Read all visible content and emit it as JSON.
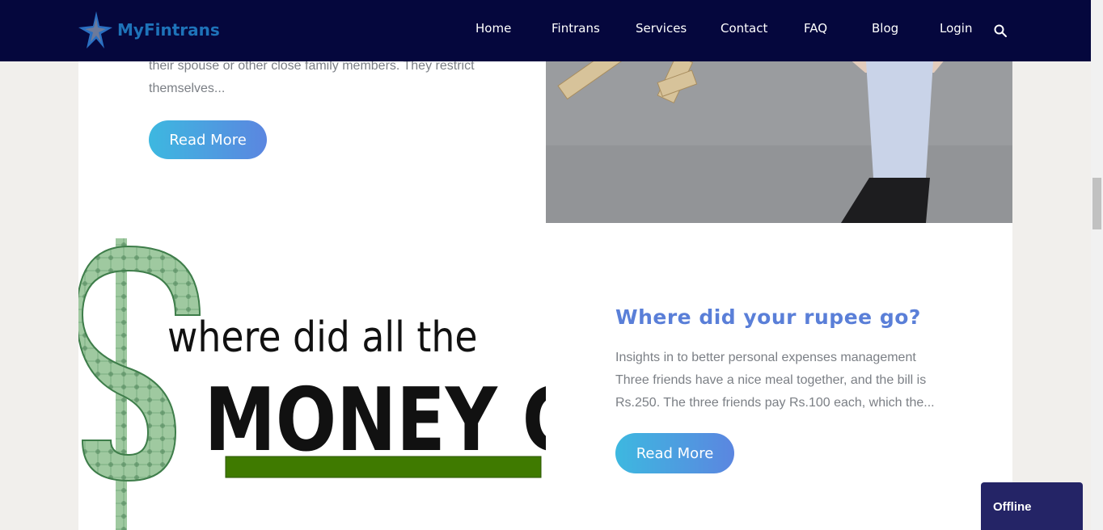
{
  "header": {
    "logo_text": "MyFintrans",
    "nav": [
      "Home",
      "Fintrans",
      "Services",
      "Contact",
      "FAQ",
      "Blog",
      "Login"
    ],
    "search_icon": "search-icon"
  },
  "posts": [
    {
      "excerpt_lines": [
        "their spouse or other close family members. They restrict",
        "themselves..."
      ],
      "read_more": "Read More"
    },
    {
      "image_text_line1": "where did all the",
      "image_text_line2": "MONEY GO?",
      "title": "Where did your rupee go?",
      "excerpt_lines": [
        "Insights in to better personal expenses management",
        "Three friends have a nice meal together, and the bill is",
        "Rs.250. The three friends pay Rs.100 each, which the..."
      ],
      "read_more": "Read More"
    }
  ],
  "chat": {
    "status": "Offline"
  },
  "colors": {
    "header_bg": "#05073d",
    "title": "#5a7fd8",
    "button_start": "#3db8e0",
    "button_end": "#5b86e0",
    "chat_bg": "#242466"
  }
}
